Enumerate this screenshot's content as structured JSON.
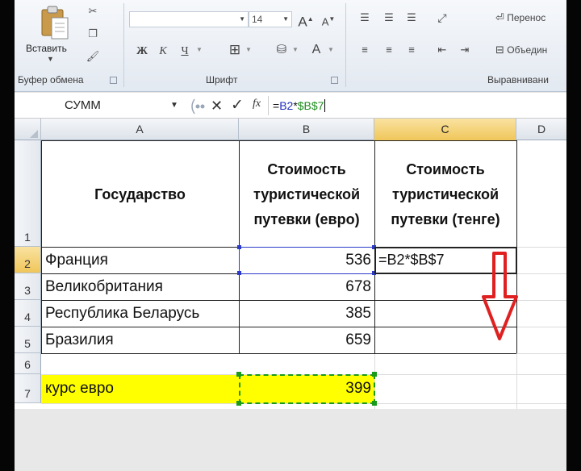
{
  "ribbon": {
    "clipboard": {
      "paste_label": "Вставить",
      "group_label": "Буфер обмена"
    },
    "font": {
      "font_name": "",
      "font_size": "14",
      "grow_font": "A",
      "shrink_font": "A",
      "bold": "Ж",
      "italic": "К",
      "underline": "Ч",
      "font_color": "A",
      "group_label": "Шрифт"
    },
    "alignment": {
      "wrap_text": "Перенос",
      "merge": "Объедин",
      "group_label": "Выравнивани"
    }
  },
  "formula_bar": {
    "name_box": "СУММ",
    "fx_label": "fx",
    "formula_prefix": "=",
    "formula_ref1": "B2",
    "formula_op": "*",
    "formula_ref2": "$B$7"
  },
  "sheet": {
    "columns": [
      "A",
      "B",
      "C",
      "D"
    ],
    "rows": [
      "1",
      "2",
      "3",
      "4",
      "5",
      "6",
      "7"
    ],
    "header": {
      "a": "Государство",
      "b_line1": "Стоимость",
      "b_line2": "туристической",
      "b_line3": "путевки (евро)",
      "c_line1": "Стоимость",
      "c_line2": "туристической",
      "c_line3": "путевки (тенге)"
    },
    "data": [
      {
        "country": "Франция",
        "price": "536"
      },
      {
        "country": "Великобритания",
        "price": "678"
      },
      {
        "country": "Республика Беларусь",
        "price": "385"
      },
      {
        "country": "Бразилия",
        "price": "659"
      }
    ],
    "c2_edit": "=B2*$B$7",
    "rate_label": "курс евро",
    "rate_value": "399"
  },
  "colors": {
    "ref_b2": "#1f2dbf",
    "ref_b7": "#1e8c1e",
    "highlight": "#ffff00",
    "arrow": "#e02020"
  }
}
